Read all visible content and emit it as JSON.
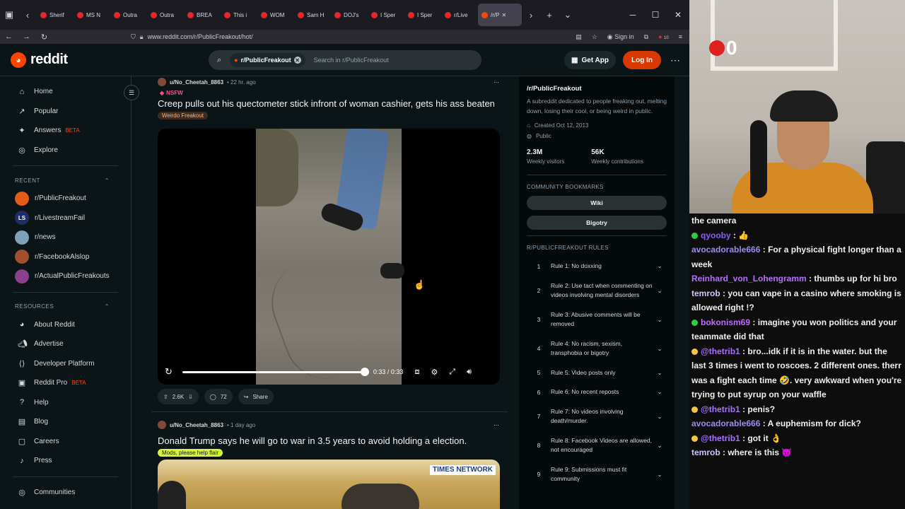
{
  "browser": {
    "tabs": [
      "Sherif",
      "MS N",
      "Outra",
      "Outra",
      "BREA",
      "This i",
      "WOM",
      "Sam H",
      "DOJ's",
      "I Sper",
      "I Sper",
      "r/Live",
      "/r/P"
    ],
    "url": "www.reddit.com/r/PublicFreakout/hot/",
    "sign_in": "Sign in",
    "badge_count": "10"
  },
  "header": {
    "logo_text": "reddit",
    "search_chip": "r/PublicFreakout",
    "search_placeholder": "Search in r/PublicFreakout",
    "get_app": "Get App",
    "login": "Log In"
  },
  "sidebar": {
    "main": [
      {
        "label": "Home",
        "icon": "home-icon"
      },
      {
        "label": "Popular",
        "icon": "popular-icon"
      },
      {
        "label": "Answers",
        "icon": "answers-icon",
        "badge": "BETA"
      },
      {
        "label": "Explore",
        "icon": "explore-icon"
      }
    ],
    "recent_heading": "RECENT",
    "recent": [
      {
        "label": "r/PublicFreakout",
        "color": "#e55b1a",
        "abbr": ""
      },
      {
        "label": "r/LivestreamFail",
        "color": "#1f2e66",
        "abbr": "LS"
      },
      {
        "label": "r/news",
        "color": "#7fa1b8",
        "abbr": ""
      },
      {
        "label": "r/FacebookAlslop",
        "color": "#a0502d",
        "abbr": ""
      },
      {
        "label": "r/ActualPublicFreakouts",
        "color": "#8a3f8f",
        "abbr": ""
      }
    ],
    "resources_heading": "RESOURCES",
    "resources": [
      {
        "label": "About Reddit",
        "icon": "reddit-icon"
      },
      {
        "label": "Advertise",
        "icon": "megaphone-icon"
      },
      {
        "label": "Developer Platform",
        "icon": "code-icon"
      },
      {
        "label": "Reddit Pro",
        "icon": "pro-icon",
        "badge": "BETA"
      },
      {
        "label": "Help",
        "icon": "help-icon"
      },
      {
        "label": "Blog",
        "icon": "book-icon"
      },
      {
        "label": "Careers",
        "icon": "briefcase-icon"
      },
      {
        "label": "Press",
        "icon": "mic-icon"
      }
    ],
    "communities": "Communities"
  },
  "post1": {
    "author": "u/No_Cheetah_8863",
    "time": "• 22 hr. ago",
    "nsfw": "NSFW",
    "title": "Creep pulls out his quectometer stick infront of woman cashier, gets his ass beaten",
    "flair": "Weirdo Freakout",
    "video_time": "0:33 / 0:33",
    "progress": 1.0,
    "upvotes": "2.6K",
    "comments": "72",
    "share": "Share"
  },
  "post2": {
    "author": "u/No_Cheetah_8863",
    "time": "• 1 day ago",
    "title": "Donald Trump says he will go to war in 3.5 years to avoid holding a election.",
    "flair": "Mods, please help flair",
    "thumb_brand": "TIMES NETWORK"
  },
  "subreddit": {
    "name": "/r/PublicFreakout",
    "description": "A subreddit dedicated to people freaking out, melting down, losing their cool, or being weird in public.",
    "created": "Created Oct 12, 2013",
    "visibility": "Public",
    "visitors": "2.3M",
    "visitors_label": "Weekly visitors",
    "contributions": "56K",
    "contributions_label": "Weekly contributions",
    "bookmarks_heading": "COMMUNITY BOOKMARKS",
    "bookmarks": [
      "Wiki",
      "Bigotry"
    ],
    "rules_heading": "R/PUBLICFREAKOUT RULES",
    "rules": [
      {
        "n": "1",
        "text": "Rule 1: No doxxing"
      },
      {
        "n": "2",
        "text": "Rule 2: Use tact when commenting on videos involving mental disorders"
      },
      {
        "n": "3",
        "text": "Rule 3: Abusive comments will be removed"
      },
      {
        "n": "4",
        "text": "Rule 4: No racism, sexism, transphobia or bigotry"
      },
      {
        "n": "5",
        "text": "Rule 5: Video posts only"
      },
      {
        "n": "6",
        "text": "Rule 6: No recent reposts"
      },
      {
        "n": "7",
        "text": "Rule 7: No videos involving death/murder."
      },
      {
        "n": "8",
        "text": "Rule 8: Facebook Videos are allowed, not encouraged"
      },
      {
        "n": "9",
        "text": "Rule 9: Submissions must fit community"
      }
    ]
  },
  "stream": {
    "counter": "0",
    "chat": [
      {
        "user": "",
        "color": "#efeff1",
        "text": "the camera",
        "badge": ""
      },
      {
        "user": "qyooby",
        "color": "#8a5cf6",
        "text": ": 👍",
        "badge": "#2ecc40"
      },
      {
        "user": "avocadorable666",
        "color": "#9b8cf0",
        "text": ": For a physical fight longer than a week",
        "badge": ""
      },
      {
        "user": "Reinhard_von_Lohengramm",
        "color": "#b370ff",
        "text": ": thumbs up for hi bro",
        "badge": ""
      },
      {
        "user": "temrob",
        "color": "#c8c8ff",
        "text": ": you can vape in a casino where smoking is allowed right !?",
        "badge": ""
      },
      {
        "user": "bokonism69",
        "color": "#c06cff",
        "text": ": imagine you won politics and your teammate did that",
        "badge": "#2ecc40"
      },
      {
        "user": "@thetrib1",
        "color": "#a970ff",
        "text": ": bro...idk if it is in the water. but the last 3 times i went to roscoes. 2 different ones. therr was a fight each time 🤣. very awkward when you're trying to put syrup on your waffle",
        "badge": "#f5c542"
      },
      {
        "user": "@thetrib1",
        "color": "#a970ff",
        "text": ": penis?",
        "badge": "#f5c542"
      },
      {
        "user": "avocadorable666",
        "color": "#9b8cf0",
        "text": ": A euphemism for dick?",
        "badge": ""
      },
      {
        "user": "@thetrib1",
        "color": "#a970ff",
        "text": ": got it 👌",
        "badge": "#f5c542"
      },
      {
        "user": "temrob",
        "color": "#c8c8ff",
        "text": ": where is this 👿",
        "badge": ""
      }
    ]
  }
}
